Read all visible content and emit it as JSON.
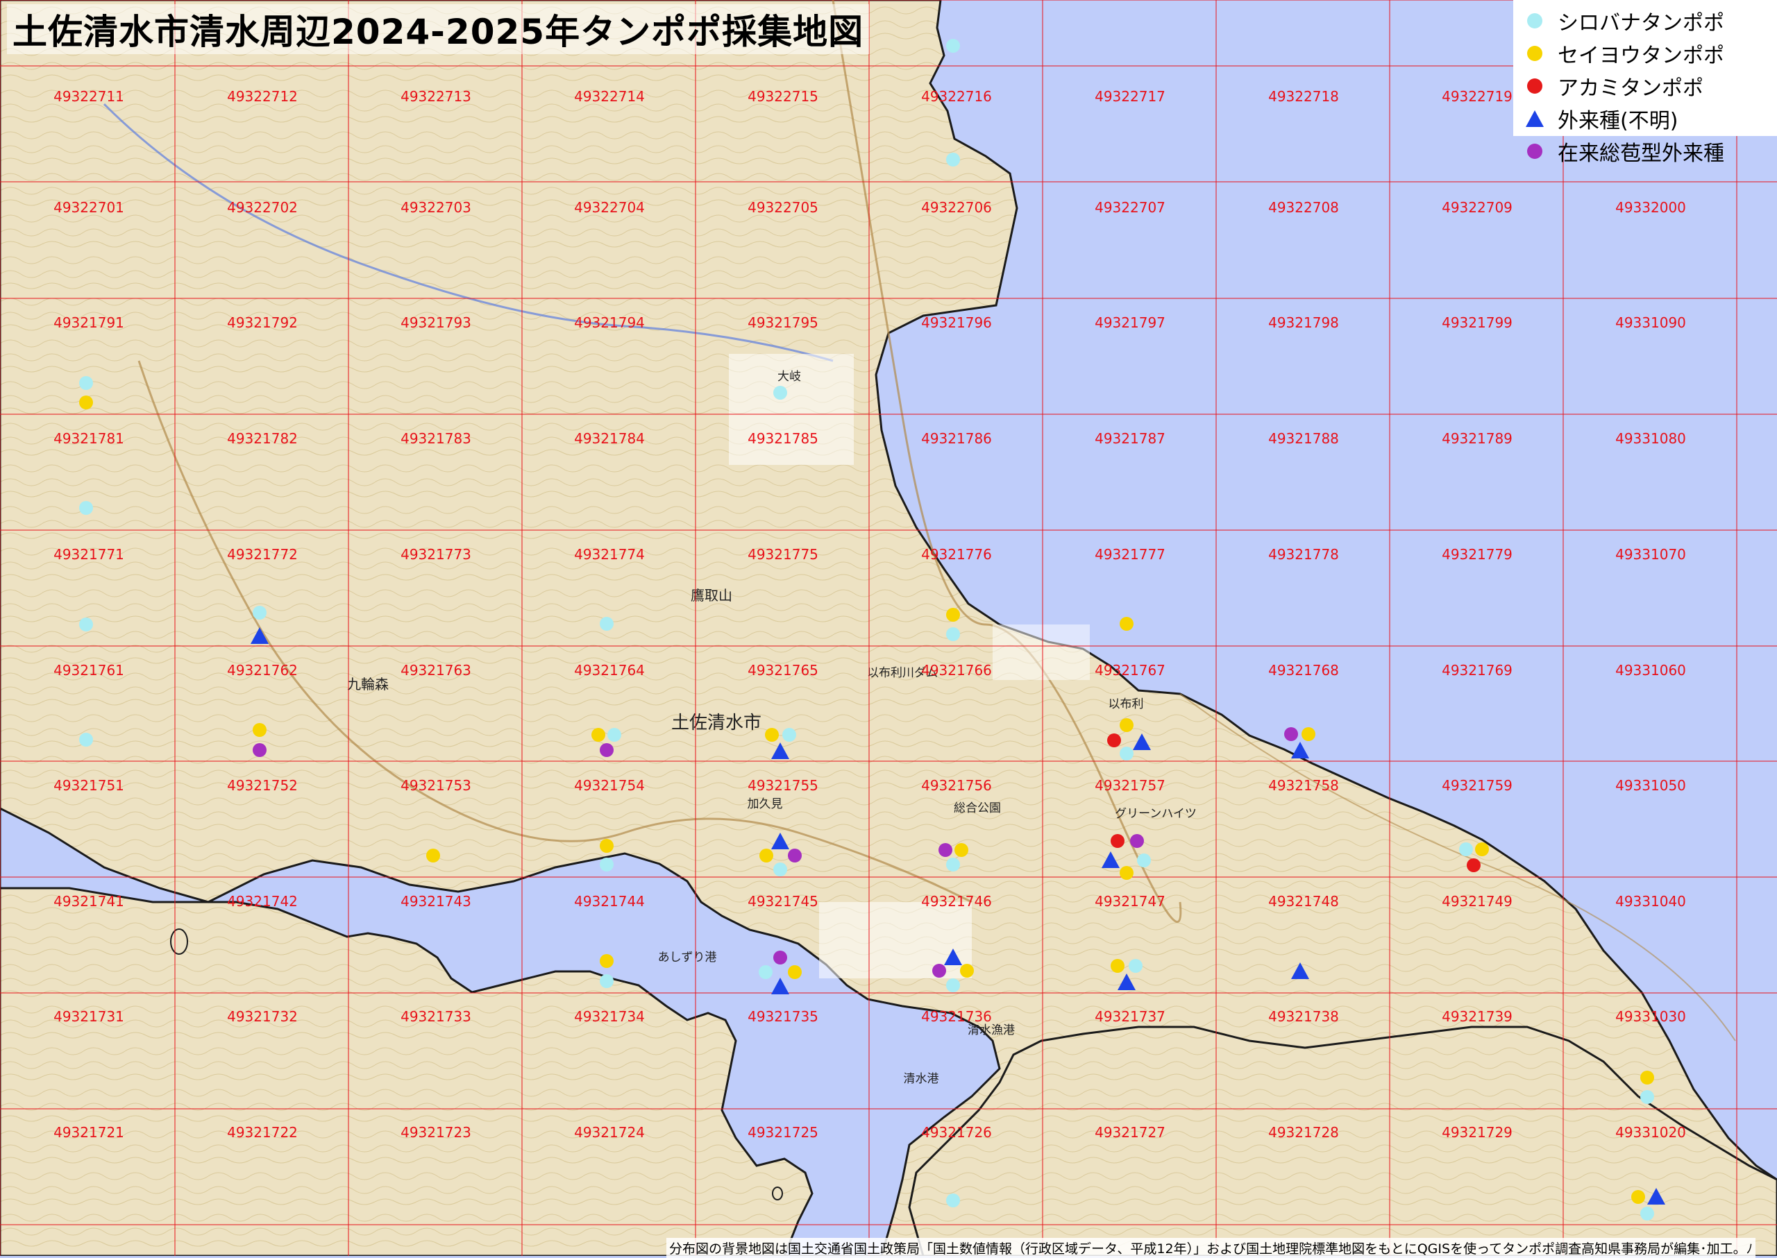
{
  "title": "土佐清水市清水周辺2024-2025年タンポポ採集地図",
  "legend": [
    {
      "label": "シロバナタンポポ",
      "color": "#a9ecf3",
      "shape": "circle"
    },
    {
      "label": "セイヨウタンポポ",
      "color": "#f7d400",
      "shape": "circle"
    },
    {
      "label": "アカミタンポポ",
      "color": "#e51a1a",
      "shape": "circle"
    },
    {
      "label": "外来種(不明)",
      "color": "#1d43e6",
      "shape": "triangle"
    },
    {
      "label": "在来総苞型外来種",
      "color": "#a52fc0",
      "shape": "circle"
    }
  ],
  "credit": "分布図の背景地図は国土交通省国土政策局「国土数値情報（行政区域データ、平成12年）」および国土地理院標準地図をもとにQGISを使ってタンポポ調査高知県事務局が編集･加工。ﾉ",
  "colors": {
    "sea": "#bfcdfa",
    "land": "#ede2c3",
    "grid": "#e8121a",
    "shiro": "#a9ecf3",
    "seiyo": "#f7d400",
    "akami": "#e51a1a",
    "gairai": "#1d43e6",
    "zairai": "#a52fc0"
  },
  "place_names": [
    "土佐清水市",
    "九輪森",
    "鷹取山",
    "あしずり港",
    "清水港",
    "グリーンハイツ",
    "総合公園",
    "以布利",
    "加久見",
    "大岐",
    "清水漁港",
    "以布利川ダム"
  ],
  "mesh_codes": [
    [
      "49322711",
      "49322712",
      "49322713",
      "49322714",
      "49322715",
      "49322716",
      "49322717",
      "49322718",
      "49322719",
      ""
    ],
    [
      "49322701",
      "49322702",
      "49322703",
      "49322704",
      "49322705",
      "49322706",
      "49322707",
      "49322708",
      "49322709",
      "49332000"
    ],
    [
      "49321791",
      "49321792",
      "49321793",
      "49321794",
      "49321795",
      "49321796",
      "49321797",
      "49321798",
      "49321799",
      "49331090"
    ],
    [
      "49321781",
      "49321782",
      "49321783",
      "49321784",
      "49321785",
      "49321786",
      "49321787",
      "49321788",
      "49321789",
      "49331080"
    ],
    [
      "49321771",
      "49321772",
      "49321773",
      "49321774",
      "49321775",
      "49321776",
      "49321777",
      "49321778",
      "49321779",
      "49331070"
    ],
    [
      "49321761",
      "49321762",
      "49321763",
      "49321764",
      "49321765",
      "49321766",
      "49321767",
      "49321768",
      "49321769",
      "49331060"
    ],
    [
      "49321751",
      "49321752",
      "49321753",
      "49321754",
      "49321755",
      "49321756",
      "49321757",
      "49321758",
      "49321759",
      "49331050"
    ],
    [
      "49321741",
      "49321742",
      "49321743",
      "49321744",
      "49321745",
      "49321746",
      "49321747",
      "49321748",
      "49321749",
      "49331040"
    ],
    [
      "49321731",
      "49321732",
      "49321733",
      "49321734",
      "49321735",
      "49321736",
      "49321737",
      "49321738",
      "49321739",
      "49331030"
    ],
    [
      "49321721",
      "49321722",
      "49321723",
      "49321724",
      "49321725",
      "49321726",
      "49321727",
      "49321728",
      "49321729",
      "49331020"
    ]
  ],
  "records": [
    {
      "species": "shiro",
      "mesh": "49322716",
      "in_mesh": "upper-left"
    },
    {
      "species": "shiro",
      "mesh": "49322706",
      "in_mesh": "upper-left"
    },
    {
      "species": "shiro",
      "mesh": "49321781",
      "in_mesh": "top"
    },
    {
      "species": "seiyo",
      "mesh": "49321781",
      "in_mesh": "top"
    },
    {
      "species": "shiro",
      "mesh": "49321795",
      "in_mesh": "bottom"
    },
    {
      "species": "shiro",
      "mesh": "49321771",
      "in_mesh": "top"
    },
    {
      "species": "shiro",
      "mesh": "49321761",
      "in_mesh": "top"
    },
    {
      "species": "shiro",
      "mesh": "49321751",
      "in_mesh": "top"
    },
    {
      "species": "shiro",
      "mesh": "49321762",
      "in_mesh": "top"
    },
    {
      "species": "gairai",
      "mesh": "49321762",
      "in_mesh": "top"
    },
    {
      "species": "seiyo",
      "mesh": "49321752",
      "in_mesh": "top"
    },
    {
      "species": "zairai",
      "mesh": "49321752",
      "in_mesh": "top"
    },
    {
      "species": "shiro",
      "mesh": "49321764",
      "in_mesh": "top"
    },
    {
      "species": "seiyo",
      "mesh": "49321754",
      "in_mesh": "top"
    },
    {
      "species": "shiro",
      "mesh": "49321754",
      "in_mesh": "top"
    },
    {
      "species": "zairai",
      "mesh": "49321754",
      "in_mesh": "top"
    },
    {
      "species": "seiyo",
      "mesh": "49321755",
      "in_mesh": "top"
    },
    {
      "species": "shiro",
      "mesh": "49321755",
      "in_mesh": "top"
    },
    {
      "species": "gairai",
      "mesh": "49321755",
      "in_mesh": "top"
    },
    {
      "species": "seiyo",
      "mesh": "49321766",
      "in_mesh": "top"
    },
    {
      "species": "shiro",
      "mesh": "49321766",
      "in_mesh": "top"
    },
    {
      "species": "seiyo",
      "mesh": "49321767",
      "in_mesh": "top"
    },
    {
      "species": "seiyo",
      "mesh": "49321757",
      "in_mesh": "top"
    },
    {
      "species": "akami",
      "mesh": "49321757",
      "in_mesh": "top"
    },
    {
      "species": "shiro",
      "mesh": "49321757",
      "in_mesh": "top"
    },
    {
      "species": "gairai",
      "mesh": "49321757",
      "in_mesh": "top"
    },
    {
      "species": "zairai",
      "mesh": "49321758",
      "in_mesh": "top"
    },
    {
      "species": "seiyo",
      "mesh": "49321758",
      "in_mesh": "top"
    },
    {
      "species": "gairai",
      "mesh": "49321758",
      "in_mesh": "top"
    },
    {
      "species": "seiyo",
      "mesh": "49321743",
      "in_mesh": "top"
    },
    {
      "species": "seiyo",
      "mesh": "49321744",
      "in_mesh": "top"
    },
    {
      "species": "shiro",
      "mesh": "49321744",
      "in_mesh": "top"
    },
    {
      "species": "gairai",
      "mesh": "49321745",
      "in_mesh": "top"
    },
    {
      "species": "seiyo",
      "mesh": "49321745",
      "in_mesh": "top"
    },
    {
      "species": "zairai",
      "mesh": "49321745",
      "in_mesh": "top"
    },
    {
      "species": "shiro",
      "mesh": "49321745",
      "in_mesh": "top"
    },
    {
      "species": "zairai",
      "mesh": "49321746",
      "in_mesh": "top"
    },
    {
      "species": "seiyo",
      "mesh": "49321746",
      "in_mesh": "top"
    },
    {
      "species": "shiro",
      "mesh": "49321746",
      "in_mesh": "top"
    },
    {
      "species": "akami",
      "mesh": "49321747",
      "in_mesh": "top"
    },
    {
      "species": "zairai",
      "mesh": "49321747",
      "in_mesh": "top"
    },
    {
      "species": "gairai",
      "mesh": "49321747",
      "in_mesh": "top"
    },
    {
      "species": "seiyo",
      "mesh": "49321747",
      "in_mesh": "top"
    },
    {
      "species": "shiro",
      "mesh": "49321747",
      "in_mesh": "top"
    },
    {
      "species": "shiro",
      "mesh": "49321749",
      "in_mesh": "top"
    },
    {
      "species": "seiyo",
      "mesh": "49321749",
      "in_mesh": "top"
    },
    {
      "species": "akami",
      "mesh": "49321749",
      "in_mesh": "top"
    },
    {
      "species": "seiyo",
      "mesh": "49321734",
      "in_mesh": "top"
    },
    {
      "species": "shiro",
      "mesh": "49321734",
      "in_mesh": "top"
    },
    {
      "species": "zairai",
      "mesh": "49321735",
      "in_mesh": "top"
    },
    {
      "species": "shiro",
      "mesh": "49321735",
      "in_mesh": "top"
    },
    {
      "species": "seiyo",
      "mesh": "49321735",
      "in_mesh": "top"
    },
    {
      "species": "gairai",
      "mesh": "49321735",
      "in_mesh": "top"
    },
    {
      "species": "gairai",
      "mesh": "49321736",
      "in_mesh": "top"
    },
    {
      "species": "zairai",
      "mesh": "49321736",
      "in_mesh": "top"
    },
    {
      "species": "seiyo",
      "mesh": "49321736",
      "in_mesh": "top"
    },
    {
      "species": "shiro",
      "mesh": "49321736",
      "in_mesh": "top"
    },
    {
      "species": "seiyo",
      "mesh": "49321737",
      "in_mesh": "top"
    },
    {
      "species": "shiro",
      "mesh": "49321737",
      "in_mesh": "top"
    },
    {
      "species": "gairai",
      "mesh": "49321737",
      "in_mesh": "top"
    },
    {
      "species": "gairai",
      "mesh": "49321738",
      "in_mesh": "top"
    },
    {
      "species": "seiyo",
      "mesh": "49331020",
      "in_mesh": "top"
    },
    {
      "species": "shiro",
      "mesh": "49331020",
      "in_mesh": "top"
    },
    {
      "species": "shiro",
      "mesh": "49321726",
      "in_mesh": "bottom"
    },
    {
      "species": "seiyo",
      "mesh": "49331020",
      "in_mesh": "bottom"
    },
    {
      "species": "gairai",
      "mesh": "49331020",
      "in_mesh": "bottom"
    },
    {
      "species": "shiro",
      "mesh": "49331020",
      "in_mesh": "bottom"
    }
  ]
}
